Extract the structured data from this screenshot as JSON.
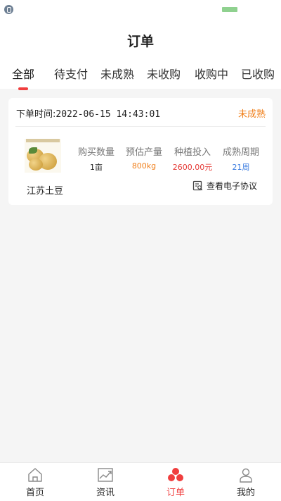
{
  "page": {
    "title": "订单"
  },
  "tabs": [
    {
      "label": "全部",
      "active": true
    },
    {
      "label": "待支付",
      "active": false
    },
    {
      "label": "未成熟",
      "active": false
    },
    {
      "label": "未收购",
      "active": false
    },
    {
      "label": "收购中",
      "active": false
    },
    {
      "label": "已收购",
      "active": false
    }
  ],
  "order": {
    "time_label": "下单时间:",
    "time_value": "2022-06-15 14:43:01",
    "status": "未成熟",
    "product_name": "江苏土豆",
    "stats": [
      {
        "key": "购买数量",
        "value": "1亩",
        "color": "#222222"
      },
      {
        "key": "预估产量",
        "value": "800kg",
        "color": "#f07f1a"
      },
      {
        "key": "种植投入",
        "value": "2600.00元",
        "color": "#e53935"
      },
      {
        "key": "成熟周期",
        "value": "21周",
        "color": "#3a7be0"
      }
    ],
    "contract_link": "查看电子协议"
  },
  "bottom_nav": [
    {
      "label": "首页",
      "icon": "home-icon",
      "active": false
    },
    {
      "label": "资讯",
      "icon": "chart-news-icon",
      "active": false
    },
    {
      "label": "订单",
      "icon": "orders-icon",
      "active": true
    },
    {
      "label": "我的",
      "icon": "profile-icon",
      "active": false
    }
  ],
  "colors": {
    "accent": "#f03e3e",
    "status_orange": "#f07f1a",
    "background": "#f5f5f5"
  }
}
